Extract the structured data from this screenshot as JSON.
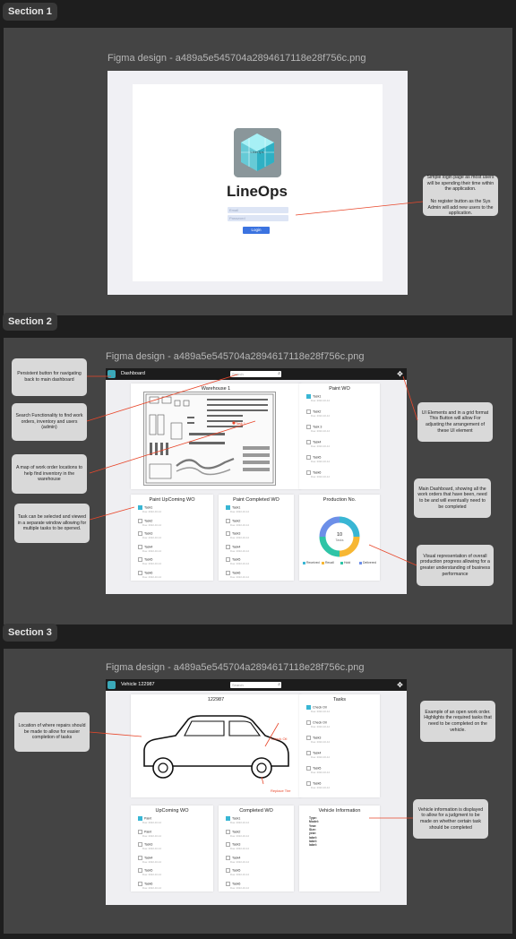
{
  "sections": [
    {
      "tab": "Section 1",
      "figma_title": "Figma design - a489a5e545704a2894617118e28f756c.png"
    },
    {
      "tab": "Section 2",
      "figma_title": "Figma design - a489a5e545704a2894617118e28f756c.png"
    },
    {
      "tab": "Section 3",
      "figma_title": "Figma design - a489a5e545704a2894617118e28f756c.png"
    }
  ],
  "login": {
    "app_name": "LineOps",
    "logo_text": "LineOps",
    "email_placeholder": "Email",
    "password_placeholder": "Password",
    "login_label": "Login",
    "note": "Simple login page as most users will be spending their time within the application.\n\nNo register button as the Sys Admin will add new users to the application."
  },
  "dashboard": {
    "title": "Dashboard",
    "search_placeholder": "Search",
    "warehouse_title": "Warehouse 1",
    "map_label": "Task 1",
    "paint_wo": {
      "title": "Paint WO",
      "tasks": [
        {
          "name": "Task1",
          "date": "Due: 2022-10-14",
          "checked": true
        },
        {
          "name": "Task2",
          "date": "Due: 2022-10-14",
          "checked": false
        },
        {
          "name": "Task 3",
          "date": "Due: 2022-10-14",
          "checked": false
        },
        {
          "name": "Task4",
          "date": "Due: 2022-10-14",
          "checked": false
        },
        {
          "name": "Task5",
          "date": "Due: 2022-10-14",
          "checked": false
        },
        {
          "name": "Task6",
          "date": "Due: 2022-10-14",
          "checked": false
        }
      ]
    },
    "upcoming_wo": {
      "title": "Paint UpComing WO",
      "tasks": [
        {
          "name": "Task1",
          "date": "Due: 2022-10-14",
          "checked": true
        },
        {
          "name": "Task2",
          "date": "Due: 2022-10-14",
          "checked": false
        },
        {
          "name": "Task3",
          "date": "Due: 2022-10-14",
          "checked": false
        },
        {
          "name": "Task4",
          "date": "Due: 2022-10-14",
          "checked": false
        },
        {
          "name": "Task5",
          "date": "Due: 2022-10-14",
          "checked": false
        },
        {
          "name": "Task6",
          "date": "Due: 2022-10-14",
          "checked": false
        }
      ]
    },
    "completed_wo": {
      "title": "Paint Completed WO",
      "tasks": [
        {
          "name": "Task1",
          "date": "Due: 2022-10-14",
          "checked": true
        },
        {
          "name": "Task2",
          "date": "Due: 2022-10-14",
          "checked": false
        },
        {
          "name": "Task3",
          "date": "Due: 2022-10-14",
          "checked": false
        },
        {
          "name": "Task4",
          "date": "Due: 2022-10-14",
          "checked": false
        },
        {
          "name": "Task5",
          "date": "Due: 2022-10-14",
          "checked": false
        },
        {
          "name": "Task6",
          "date": "Due: 2022-10-14",
          "checked": false
        }
      ]
    },
    "production": {
      "title": "Production No.",
      "center_value": "10",
      "center_label": "Tasks"
    },
    "notes": {
      "home": "Persistent button for navigating back to main dashboard",
      "search": "Search Functionality to find work orders, inventory and users (admin)",
      "map": "A map of work order locations to help find inventory in the warehouse",
      "tasks": "Task can be selected and viewed in a separate window allowing for multiple tasks to be opened.",
      "grid": "UI Elements and in a grid format This Button will allow For adjusting the arrangement of these UI element",
      "main": "Main Dashboard, showing all the work orders that have been, need to be and will eventually need to be completed",
      "visual": "Visual representation of overall production progress allowing for a greater understanding of business performance"
    }
  },
  "chart_data": {
    "type": "pie",
    "title": "Production No.",
    "categories": [
      "Received",
      "Recall",
      "Hold",
      "Delivered"
    ],
    "values": [
      25,
      25,
      25,
      25
    ],
    "colors": [
      "#39b6d4",
      "#f7b733",
      "#2ec4a6",
      "#6c8fe8"
    ],
    "center": "10 Tasks"
  },
  "vehicle": {
    "title": "Vehicle 122987",
    "search_placeholder": "Search",
    "panel_title": "122987",
    "labels": {
      "check_oil": "Check Oil",
      "replace_tire": "Replace Tire"
    },
    "tasks": {
      "title": "Tasks",
      "items": [
        {
          "name": "Check Oil",
          "date": "Due: 2022-10-14",
          "checked": true
        },
        {
          "name": "Check Oil",
          "date": "Due: 2022-10-14",
          "checked": false
        },
        {
          "name": "Task3",
          "date": "Due: 2022-10-14",
          "checked": false
        },
        {
          "name": "Task4",
          "date": "Due: 2022-10-14",
          "checked": false
        },
        {
          "name": "Task5",
          "date": "Due: 2022-10-14",
          "checked": false
        },
        {
          "name": "Task6",
          "date": "Due: 2022-10-14",
          "checked": false
        }
      ]
    },
    "upcoming": {
      "title": "UpComing WO",
      "items": [
        {
          "name": "Paint",
          "date": "Due: 2022-10-14",
          "checked": true
        },
        {
          "name": "Paint",
          "date": "Due: 2022-10-14",
          "checked": false
        },
        {
          "name": "Task3",
          "date": "Due: 2022-10-14",
          "checked": false
        },
        {
          "name": "Task4",
          "date": "Due: 2022-10-14",
          "checked": false
        },
        {
          "name": "Task5",
          "date": "Due: 2022-10-14",
          "checked": false
        },
        {
          "name": "Task6",
          "date": "Due: 2022-10-14",
          "checked": false
        }
      ]
    },
    "completed": {
      "title": "Completed WO",
      "items": [
        {
          "name": "Task1",
          "date": "Due: 2022-10-14",
          "checked": true
        },
        {
          "name": "Task2",
          "date": "Due: 2022-10-14",
          "checked": false
        },
        {
          "name": "Task3",
          "date": "Due: 2022-10-14",
          "checked": false
        },
        {
          "name": "Task4",
          "date": "Due: 2022-10-14",
          "checked": false
        },
        {
          "name": "Task5",
          "date": "Due: 2022-10-14",
          "checked": false
        },
        {
          "name": "Task6",
          "date": "Due: 2022-10-14",
          "checked": false
        }
      ]
    },
    "info": {
      "title": "Vehicle Information",
      "fields": [
        "Type:",
        "Model:",
        "Year:",
        "Size:",
        "year:",
        "label:",
        "label:",
        "label:"
      ]
    },
    "notes": {
      "location": "Location of where repairs should be made to allow for easier completion of tasks",
      "open_wo": "Example of an open work order. Highlights the required tasks that need to be completed on the vehicle.",
      "info": "Vehicle information is displayed to allow for a judgment to be made on whether certain task should be completed"
    }
  },
  "colors": {
    "accent": "#3b73e0",
    "arrow": "#e8472b",
    "cyan": "#39b6d4"
  }
}
